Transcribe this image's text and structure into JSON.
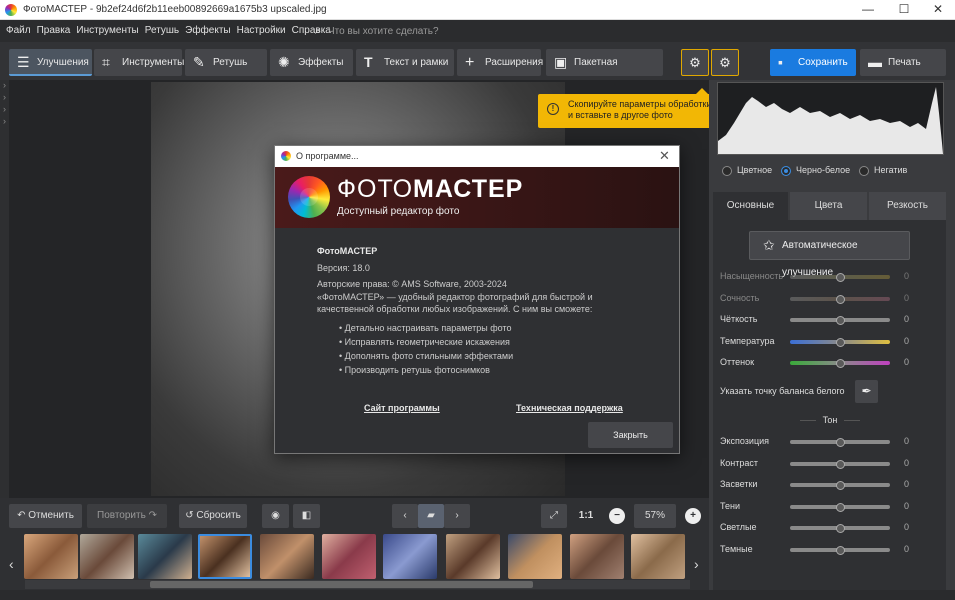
{
  "window": {
    "title": "ФотоМАСТЕР - 9b2ef24d6f2b11eeb00892669a1675b3 upscaled.jpg",
    "minimize": "—",
    "maximize": "☐",
    "close": "✕"
  },
  "menu": {
    "items": [
      "Файл",
      "Правка",
      "Инструменты",
      "Ретушь",
      "Эффекты",
      "Настройки",
      "Справка"
    ],
    "search_placeholder": "Что вы хотите сделать?"
  },
  "toolbar": {
    "tabs": [
      {
        "label": "Улучшения",
        "icon": "sliders-icon",
        "glyph": "☰"
      },
      {
        "label": "Инструменты",
        "icon": "crop-icon",
        "glyph": "⌗"
      },
      {
        "label": "Ретушь",
        "icon": "brush-icon",
        "glyph": "✎"
      },
      {
        "label": "Эффекты",
        "icon": "sparkle-icon",
        "glyph": "✺"
      },
      {
        "label": "Текст и рамки",
        "icon": "text-icon",
        "glyph": "T"
      },
      {
        "label": "Расширения",
        "icon": "plus-icon",
        "glyph": "+"
      }
    ],
    "batch_label": "Пакетная обработка",
    "save_label": "Сохранить",
    "print_label": "Печать"
  },
  "tooltip": {
    "text": "Скопируйте параметры обработки и вставьте в другое фото"
  },
  "dialog": {
    "title": "О программе...",
    "brand_light": "ФОТО",
    "brand_bold": "МАСТЕР",
    "tagline": "Доступный редактор фото",
    "product": "ФотоМАСТЕР",
    "version": "Версия: 18.0",
    "copyright": "Авторские права: © AMS Software, 2003-2024",
    "description_line1": "«ФотоМАСТЕР» — удобный редактор фотографий для быстрой и",
    "description_line2": "качественной обработки любых изображений. С ним вы сможете:",
    "features": [
      "• Детально настраивать параметры фото",
      "• Исправлять геометрические искажения",
      "• Дополнять фото стильными эффектами",
      "• Производить ретушь фотоснимков"
    ],
    "link_site": "Сайт программы",
    "link_support": "Техническая поддержка",
    "close_label": "Закрыть"
  },
  "right_panel": {
    "modes": [
      {
        "label": "Цветное",
        "selected": false
      },
      {
        "label": "Черно-белое",
        "selected": true
      },
      {
        "label": "Негатив",
        "selected": false
      }
    ],
    "tabs": [
      "Основные",
      "Цвета",
      "Резкость"
    ],
    "auto_label": "Автоматическое улучшение",
    "sliders_color": [
      {
        "label": "Насыщенность",
        "value": "0",
        "disabled": true
      },
      {
        "label": "Сочность",
        "value": "0",
        "disabled": true
      },
      {
        "label": "Чёткость",
        "value": "0",
        "disabled": false
      },
      {
        "label": "Температура",
        "value": "0",
        "disabled": false
      },
      {
        "label": "Оттенок",
        "value": "0",
        "disabled": false
      }
    ],
    "white_balance_label": "Указать точку баланса белого",
    "tone_header": "Тон",
    "sliders_tone": [
      {
        "label": "Экспозиция",
        "value": "0"
      },
      {
        "label": "Контраст",
        "value": "0"
      },
      {
        "label": "Засветки",
        "value": "0"
      },
      {
        "label": "Тени",
        "value": "0"
      },
      {
        "label": "Светлые",
        "value": "0"
      },
      {
        "label": "Темные",
        "value": "0"
      }
    ]
  },
  "bottom": {
    "undo_label": "Отменить",
    "redo_label": "Повторить",
    "reset_label": "Сбросить",
    "zoom_1to1": "1:1",
    "zoom_level": "57%"
  },
  "colors": {
    "accent": "#1a7be0",
    "tooltip_bg": "#f2b705",
    "panel_bg": "#2f3033"
  }
}
